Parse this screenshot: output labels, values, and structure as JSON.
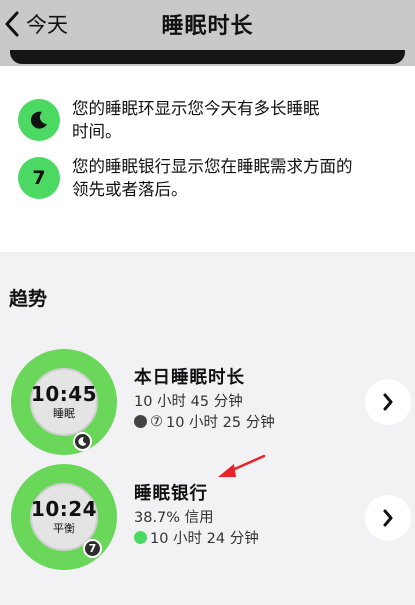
{
  "nav": {
    "back_label": "今天",
    "title": "睡眠时长"
  },
  "info": {
    "items": [
      {
        "icon": "moon-icon",
        "text_line1": "您的睡眠环显示您今天有多长睡眠",
        "text_line2": "时间。"
      },
      {
        "icon_text": "7",
        "text_line1": "您的睡眠银行显示您在睡眠需求方面的",
        "text_line2": "领先或者落后。"
      }
    ]
  },
  "trend": {
    "title": "趋势",
    "rows": [
      {
        "ring_time": "10:45",
        "ring_label": "睡眠",
        "name": "本日睡眠时长",
        "sub": "10 小时 45 分钟",
        "detail_icon_text": "⑦",
        "detail": "10 小时 25 分钟",
        "badge": "moon-icon",
        "fill_fraction": 1.0
      },
      {
        "ring_time": "10:24",
        "ring_label": "平衡",
        "name": "睡眠银行",
        "sub": "38.7% 信用",
        "detail": "10 小时 24 分钟",
        "badge_text": "7",
        "fill_fraction": 1.0
      }
    ]
  },
  "colors": {
    "accent_green": "#4cd963",
    "ring_green": "#6ad65a",
    "annotation_red": "#e8232a"
  }
}
